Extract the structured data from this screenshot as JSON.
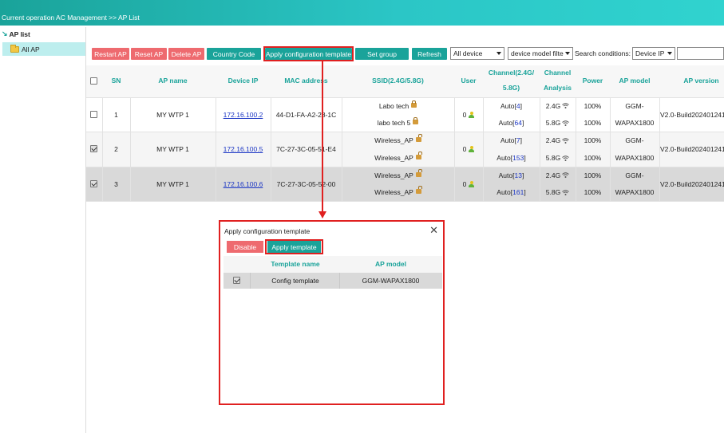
{
  "header": {
    "breadcrumb": "Current operation  AC Management >> AP List"
  },
  "sidebar": {
    "title": "AP list",
    "items": [
      {
        "label": "All AP"
      }
    ]
  },
  "toolbar": {
    "restart_ap": "Restart AP",
    "reset_ap": "Reset AP",
    "delete_ap": "Delete AP",
    "country_code": "Country Code",
    "apply_config_template": "Apply configuration template",
    "set_group": "Set group",
    "refresh": "Refresh",
    "device_filter": "All device",
    "model_filter": "device model filte",
    "search_label": "Search conditions:",
    "search_field": "Device IP",
    "search_value": ""
  },
  "table": {
    "headers": {
      "sn": "SN",
      "ap_name": "AP name",
      "device_ip": "Device IP",
      "mac": "MAC address",
      "ssid": "SSID(2.4G/5.8G)",
      "user": "User",
      "channel_a": "Channel(2.4G/",
      "channel_b": "5.8G)",
      "analysis_a": "Channel",
      "analysis_b": "Analysis",
      "power": "Power",
      "model": "AP model",
      "version": "AP version"
    },
    "rows": [
      {
        "checked": false,
        "sn": "1",
        "name": "MY WTP 1",
        "ip": "172.16.100.2",
        "mac": "44-D1-FA-A2-28-1C",
        "ssid1": "Labo tech",
        "ssid2": "labo tech 5",
        "users": "0",
        "ch1_mode": "Auto[",
        "ch1_num": "4",
        "ch2_mode": "Auto[",
        "ch2_num": "64",
        "band1": "2.4G",
        "band2": "5.8G",
        "power1": "100%",
        "power2": "100%",
        "model_a": "GGM-",
        "model_b": "WAPAX1800",
        "version": "V2.0-Build202401241"
      },
      {
        "checked": true,
        "sn": "2",
        "name": "MY WTP 1",
        "ip": "172.16.100.5",
        "mac": "7C-27-3C-05-51-E4",
        "ssid1": "Wireless_AP",
        "ssid2": "Wireless_AP",
        "users": "0",
        "ch1_mode": "Auto[",
        "ch1_num": "7",
        "ch2_mode": "Auto[",
        "ch2_num": "153",
        "band1": "2.4G",
        "band2": "5.8G",
        "power1": "100%",
        "power2": "100%",
        "model_a": "GGM-",
        "model_b": "WAPAX1800",
        "version": "V2.0-Build202401241"
      },
      {
        "checked": true,
        "sn": "3",
        "name": "MY WTP 1",
        "ip": "172.16.100.6",
        "mac": "7C-27-3C-05-52-00",
        "ssid1": "Wireless_AP",
        "ssid2": "Wireless_AP",
        "users": "0",
        "ch1_mode": "Auto[",
        "ch1_num": "13",
        "ch2_mode": "Auto[",
        "ch2_num": "161",
        "band1": "2.4G",
        "band2": "5.8G",
        "power1": "100%",
        "power2": "100%",
        "model_a": "GGM-",
        "model_b": "WAPAX1800",
        "version": "V2.0-Build202401241"
      }
    ]
  },
  "modal": {
    "title": "Apply configuration template",
    "close": "✕",
    "disable": "Disable",
    "apply": "Apply template",
    "col_template": "Template name",
    "col_model": "AP model",
    "rows": [
      {
        "checked": true,
        "template": "Config template",
        "model": "GGM-WAPAX1800"
      }
    ]
  },
  "colors": {
    "accent": "#1aa39a",
    "danger": "#ee6a6f",
    "highlight": "#e02020",
    "link": "#1a35c4"
  }
}
